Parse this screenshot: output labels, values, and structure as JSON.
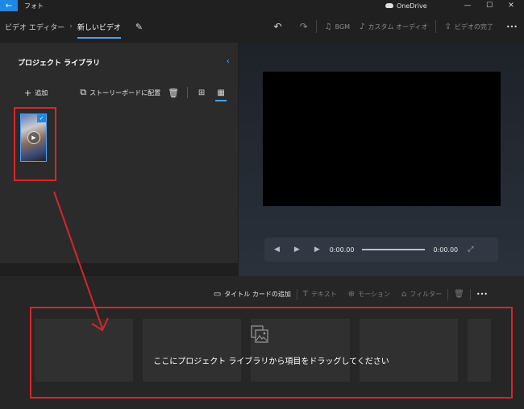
{
  "titlebar": {
    "back_glyph": "←",
    "app_title": "フォト",
    "onedrive_label": "OneDrive",
    "minimize_glyph": "—",
    "maximize_glyph": "☐",
    "close_glyph": "✕"
  },
  "toolbar": {
    "breadcrumb_parent": "ビデオ エディター",
    "breadcrumb_sep": "›",
    "breadcrumb_current": "新しいビデオ",
    "pencil_glyph": "✎",
    "undo_glyph": "↶",
    "redo_glyph": "↷",
    "bgm_label": "BGM",
    "custom_audio_label": "カスタム オーディオ",
    "finish_video_label": "ビデオの完了",
    "more_glyph": "•••"
  },
  "library": {
    "title": "プロジェクト ライブラリ",
    "collapse_glyph": "‹",
    "add_label": "追加",
    "add_glyph": "+",
    "place_storyboard_label": "ストーリーボードに配置",
    "storyboard_glyph": "⧉",
    "delete_glyph": "🗑",
    "view_large_glyph": "⊞",
    "view_small_glyph": "▦",
    "thumb_check_glyph": "✓",
    "thumb_play_glyph": "▶"
  },
  "player": {
    "prev_glyph": "◀",
    "play_glyph": "▶",
    "next_glyph": "▶",
    "current_time": "0:00.00",
    "total_time": "0:00.00",
    "expand_glyph": "⤢"
  },
  "storyboard": {
    "title_card_label": "タイトル カードの追加",
    "text_label": "テキスト",
    "motion_label": "モーション",
    "filter_label": "フィルター",
    "title_card_glyph": "▭",
    "text_glyph": "T",
    "motion_glyph": "⊕",
    "filter_glyph": "⌂",
    "delete_glyph": "🗑",
    "more_glyph": "•••",
    "drop_message": "ここにプロジェクト ライブラリから項目をドラッグしてください"
  },
  "colors": {
    "accent": "#4aa3ff",
    "highlight_red": "#d9242a",
    "back_button": "#1e88e5"
  }
}
